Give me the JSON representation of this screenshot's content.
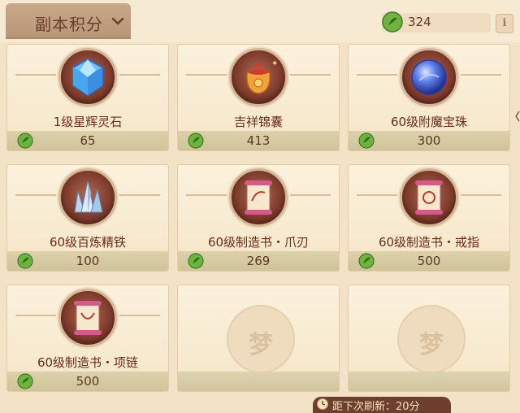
{
  "header": {
    "dropdown_label": "副本积分",
    "currency_value": "324",
    "info_glyph": "i"
  },
  "items": [
    {
      "name": "1级星辉灵石",
      "price": "65",
      "icon": "diamond-icon"
    },
    {
      "name": "吉祥锦囊",
      "price": "413",
      "icon": "pouch-icon"
    },
    {
      "name": "60级附魔宝珠",
      "price": "300",
      "icon": "orb-icon"
    },
    {
      "name": "60级百炼精铁",
      "price": "100",
      "icon": "crystal-cluster-icon"
    },
    {
      "name": "60级制造书・爪刃",
      "price": "269",
      "icon": "scroll-icon"
    },
    {
      "name": "60级制造书・戒指",
      "price": "500",
      "icon": "scroll-icon"
    },
    {
      "name": "60级制造书・项链",
      "price": "500",
      "icon": "scroll-icon"
    }
  ],
  "empty_slot_glyph": "梦",
  "footer": {
    "refresh_text": "距下次刷新：20分"
  },
  "colors": {
    "currency_green": "#5aa02e",
    "item_name": "#6b2a1a",
    "medallion": "#7c3a2a",
    "background": "#f3e3c6"
  }
}
